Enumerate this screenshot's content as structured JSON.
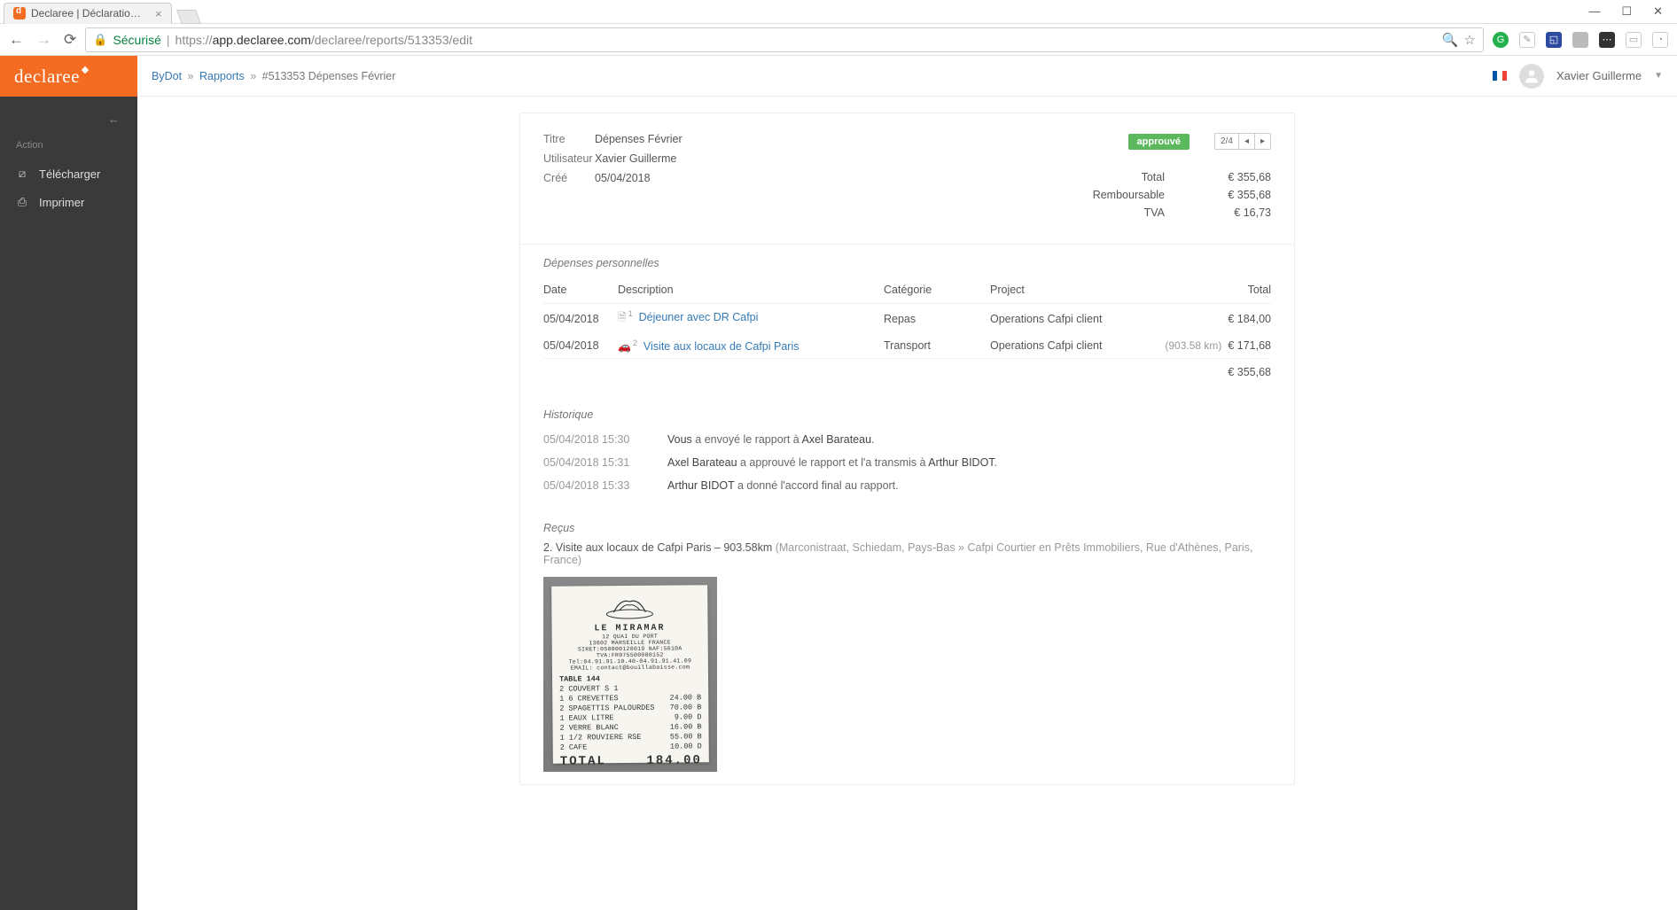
{
  "browser": {
    "tab_title": "Declaree | Déclaration de",
    "secure_label": "Sécurisé",
    "url_proto": "https://",
    "url_host": "app.declaree.com",
    "url_path": "/declaree/reports/513353/edit"
  },
  "sidebar": {
    "section": "Action",
    "items": [
      {
        "icon": "download",
        "label": "Télécharger"
      },
      {
        "icon": "print",
        "label": "Imprimer"
      }
    ]
  },
  "topbar": {
    "crumb1": "ByDot",
    "crumb2": "Rapports",
    "crumb3": "#513353 Dépenses Février",
    "user": "Xavier Guillerme"
  },
  "report": {
    "labels": {
      "title": "Titre",
      "user": "Utilisateur",
      "created": "Créé"
    },
    "title": "Dépenses Février",
    "user": "Xavier Guillerme",
    "created": "05/04/2018",
    "status": "approuvé",
    "pager": "2/4",
    "totals": {
      "total_label": "Total",
      "total": "€ 355,68",
      "reimb_label": "Remboursable",
      "reimb": "€ 355,68",
      "vat_label": "TVA",
      "vat": "€ 16,73"
    }
  },
  "expenses": {
    "section": "Dépenses personnelles",
    "headers": {
      "date": "Date",
      "desc": "Description",
      "cat": "Catégorie",
      "proj": "Project",
      "total": "Total"
    },
    "rows": [
      {
        "date": "05/04/2018",
        "icon": "file",
        "idx": "1",
        "desc": "Déjeuner avec DR Cafpi",
        "cat": "Repas",
        "proj": "Operations Cafpi client",
        "extra": "",
        "total": "€ 184,00"
      },
      {
        "date": "05/04/2018",
        "icon": "car",
        "idx": "2",
        "desc": "Visite aux locaux de Cafpi Paris",
        "cat": "Transport",
        "proj": "Operations Cafpi client",
        "extra": "(903.58 km)",
        "total": "€ 171,68"
      }
    ],
    "sum": "€ 355,68"
  },
  "history": {
    "section": "Historique",
    "rows": [
      {
        "ts": "05/04/2018 15:30",
        "a1": "Vous",
        "t1": " a envoyé le rapport à ",
        "a2": "Axel Barateau",
        "t2": "."
      },
      {
        "ts": "05/04/2018 15:31",
        "a1": "Axel Barateau",
        "t1": " a approuvé le rapport et l'a transmis à ",
        "a2": "Arthur BIDOT",
        "t2": "."
      },
      {
        "ts": "05/04/2018 15:33",
        "a1": "Arthur BIDOT",
        "t1": " a donné l'accord final au rapport.",
        "a2": "",
        "t2": ""
      }
    ]
  },
  "receipts": {
    "section": "Reçus",
    "title_main": "2. Visite aux locaux de Cafpi Paris – 903.58km",
    "title_sub": " (Marconistraat, Schiedam, Pays-Bas » Cafpi Courtier en Prêts Immobiliers, Rue d'Athènes, Paris, France)",
    "paper": {
      "name": "LE MIRAMAR",
      "addr1": "12 QUAI DU PORT",
      "addr2": "13002 MARSEILLE FRANCE",
      "tel": "Tel:04.91.91.10.40-04.91.91.41.09",
      "email": "EMAIL: contact@bouillabaisse.com",
      "table": "TABLE 144",
      "couvert": "2 COUVERT   S 1",
      "items": [
        {
          "n": "1 6 CREVETTES",
          "p": "24.00 B"
        },
        {
          "n": "2 SPAGETTIS PALOURDES",
          "p": "70.00 B"
        },
        {
          "n": "1 EAUX LITRE",
          "p": "9.00 D"
        },
        {
          "n": "2 VERRE BLANC",
          "p": "16.00 B"
        },
        {
          "n": "1 1/2 ROUVIERE RSE",
          "p": "55.00 B"
        },
        {
          "n": "2 CAFE",
          "p": "10.00 D"
        }
      ],
      "total_label": "TOTAL",
      "total_value": "184.00"
    }
  }
}
